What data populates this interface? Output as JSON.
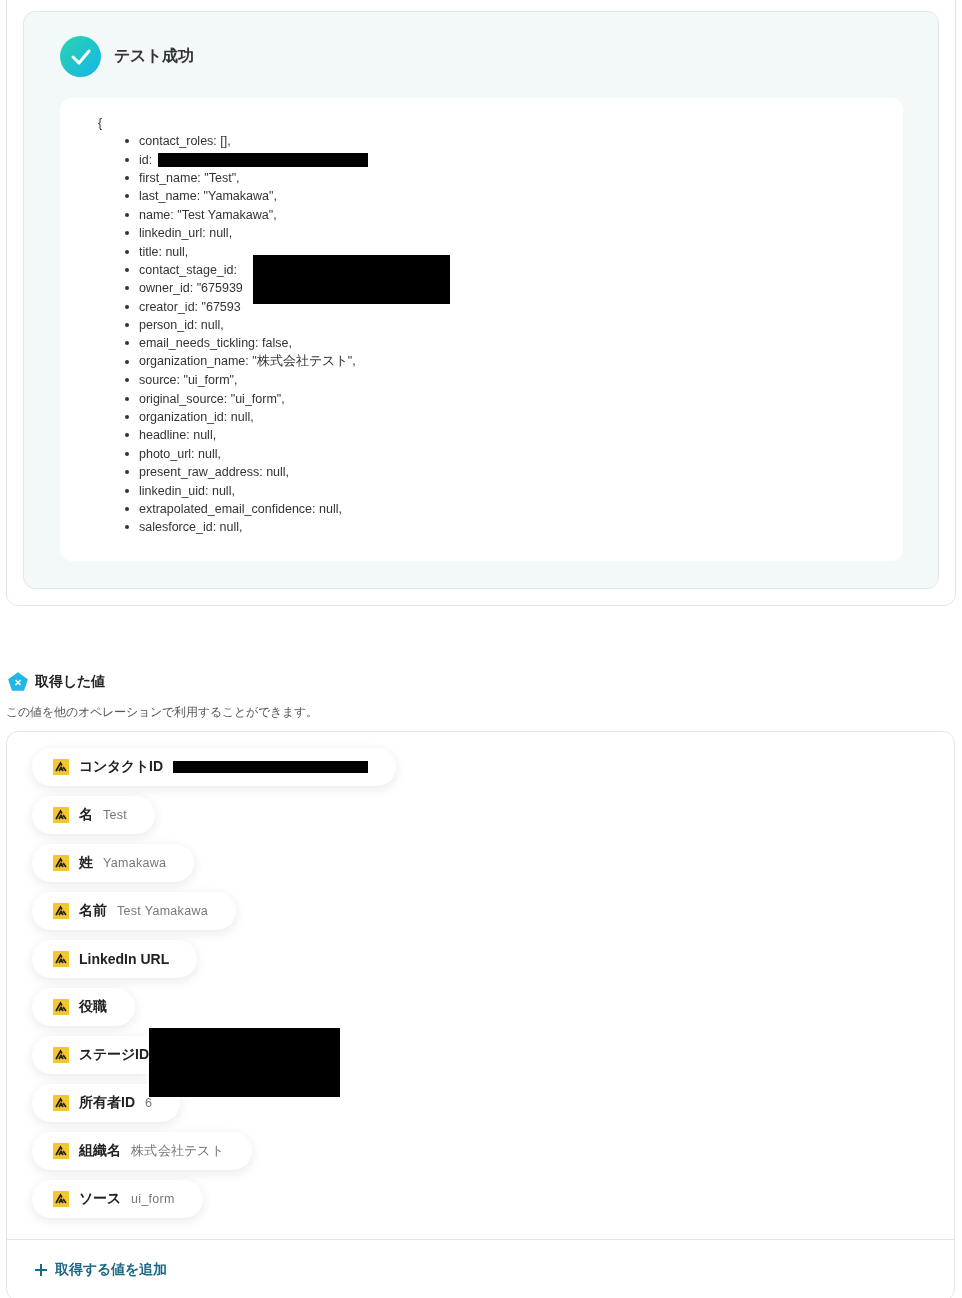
{
  "test_result": {
    "title": "テスト成功",
    "open_brace": "{",
    "lines": [
      {
        "text": "contact_roles: [],",
        "redacted": false
      },
      {
        "text": "id:",
        "redacted": true
      },
      {
        "text": "first_name: \"Test\",",
        "redacted": false
      },
      {
        "text": "last_name: \"Yamakawa\",",
        "redacted": false
      },
      {
        "text": "name: \"Test Yamakawa\",",
        "redacted": false
      },
      {
        "text": "linkedin_url: null,",
        "redacted": false
      },
      {
        "text": "title: null,",
        "redacted": false
      },
      {
        "text": "contact_stage_id:",
        "redacted": true
      },
      {
        "text": "owner_id: \"675939",
        "redacted": false
      },
      {
        "text": "creator_id: \"67593",
        "redacted": false
      },
      {
        "text": "person_id: null,",
        "redacted": false
      },
      {
        "text": "email_needs_tickling: false,",
        "redacted": false
      },
      {
        "text": "organization_name: \"株式会社テスト\",",
        "redacted": false
      },
      {
        "text": "source: \"ui_form\",",
        "redacted": false
      },
      {
        "text": "original_source: \"ui_form\",",
        "redacted": false
      },
      {
        "text": "organization_id: null,",
        "redacted": false
      },
      {
        "text": "headline: null,",
        "redacted": false
      },
      {
        "text": "photo_url: null,",
        "redacted": false
      },
      {
        "text": "present_raw_address: null,",
        "redacted": false
      },
      {
        "text": "linkedin_uid: null,",
        "redacted": false
      },
      {
        "text": "extrapolated_email_confidence: null,",
        "redacted": false
      },
      {
        "text": "salesforce_id: null,",
        "redacted": false
      }
    ]
  },
  "values": {
    "title": "取得した値",
    "description": "この値を他のオペレーションで利用することができます。",
    "items": [
      {
        "label": "コンタクトID",
        "value": "",
        "redacted": true
      },
      {
        "label": "名",
        "value": "Test",
        "redacted": false
      },
      {
        "label": "姓",
        "value": "Yamakawa",
        "redacted": false
      },
      {
        "label": "名前",
        "value": "Test Yamakawa",
        "redacted": false
      },
      {
        "label": "LinkedIn URL",
        "value": "",
        "redacted": false
      },
      {
        "label": "役職",
        "value": "",
        "redacted": false
      },
      {
        "label": "ステージID",
        "value": "",
        "redacted": true
      },
      {
        "label": "所有者ID",
        "value": "6",
        "redacted": false
      },
      {
        "label": "組織名",
        "value": "株式会社テスト",
        "redacted": false
      },
      {
        "label": "ソース",
        "value": "ui_form",
        "redacted": false
      }
    ],
    "add_button": "取得する値を追加"
  }
}
